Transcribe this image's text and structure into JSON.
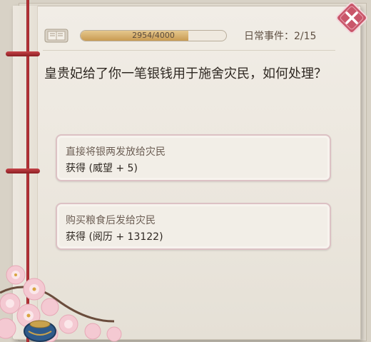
{
  "header": {
    "book_icon": "scroll-book-icon",
    "progress_current": 2954,
    "progress_max": 4000,
    "progress_text": "2954/4000",
    "event_counter": "日常事件：2/15"
  },
  "event": {
    "question": "皇贵妃给了你一笔银钱用于施舍灾民，如何处理？"
  },
  "options": [
    {
      "title": "直接将银两发放给灾民",
      "reward": "获得 (威望 + 5)"
    },
    {
      "title": "购买粮食后发给灾民",
      "reward": "获得 (阅历 + 13122)"
    }
  ],
  "icons": {
    "close": "close-x-icon",
    "decoration": "plum-blossom-decoration"
  },
  "colors": {
    "thread": "#b5333a",
    "close_button": "#c9566a",
    "option_border": "#dcc1c4",
    "progress_fill": "#d4ac68"
  }
}
